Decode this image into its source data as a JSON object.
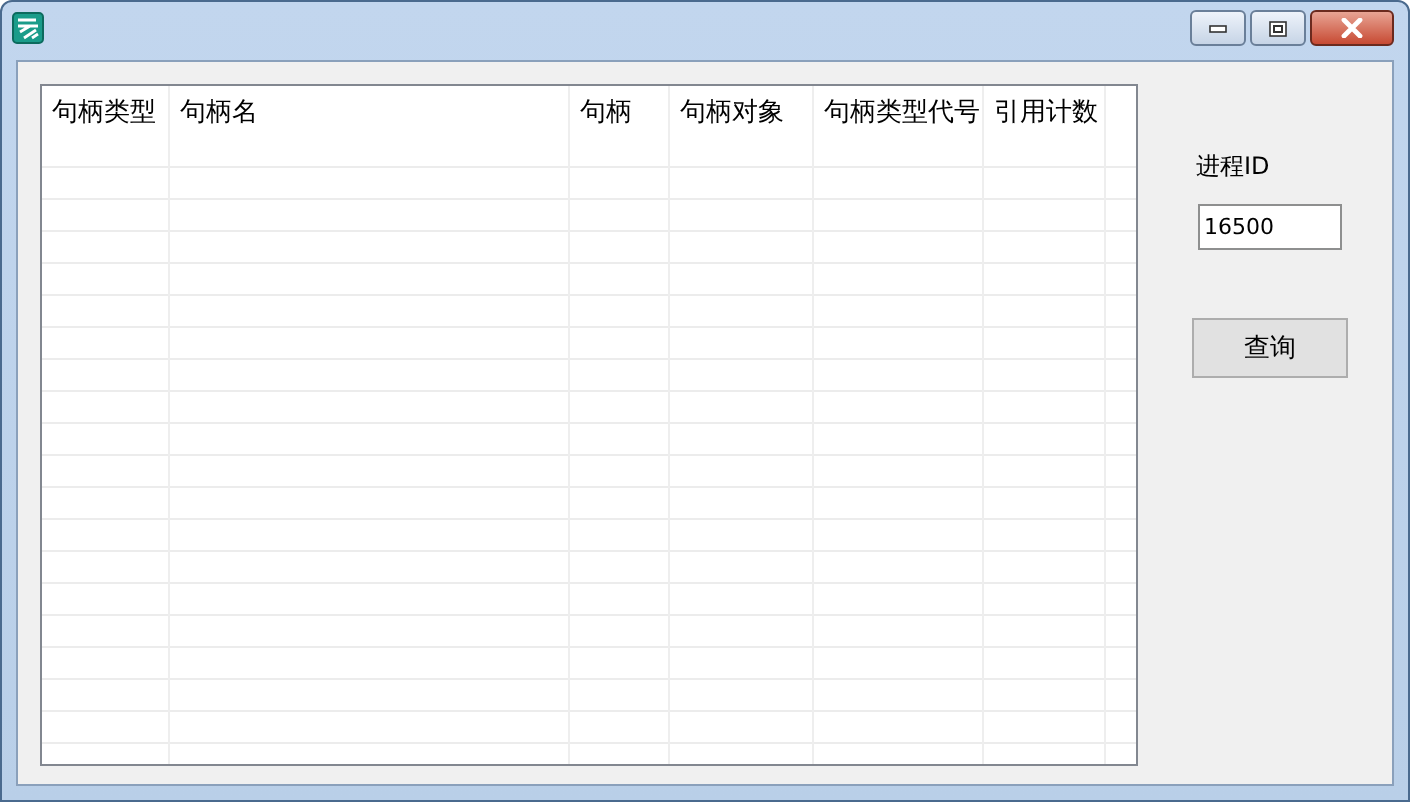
{
  "table": {
    "columns": [
      "句柄类型",
      "句柄名",
      "句柄",
      "句柄对象",
      "句柄类型代号",
      "引用计数"
    ]
  },
  "process_id": {
    "label": "进程ID",
    "value": "16500"
  },
  "query_button": {
    "label": "查询"
  }
}
